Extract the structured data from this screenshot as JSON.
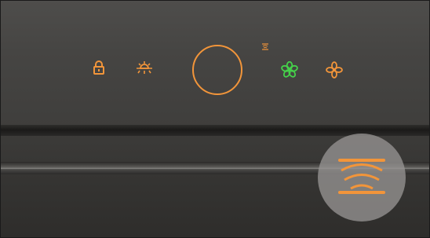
{
  "control_panel": {
    "controls": [
      {
        "icon": "lock-icon",
        "function": "child-lock"
      },
      {
        "icon": "light-bulb-icon",
        "function": "light"
      },
      {
        "icon": "power-ring-icon",
        "function": "power"
      },
      {
        "icon": "boost-indicator-icon",
        "function": "intensive-mode-indicator"
      },
      {
        "icon": "fan-icon",
        "function": "fan-speed",
        "state": "active"
      },
      {
        "icon": "fan-icon",
        "function": "fan-speed",
        "state": "inactive"
      }
    ]
  },
  "badge": {
    "icon": "breeze-sensor-icon"
  },
  "colors": {
    "accent": "#f2953a",
    "active": "#45d14a",
    "panel": "#46453f",
    "badge": "#969492"
  }
}
